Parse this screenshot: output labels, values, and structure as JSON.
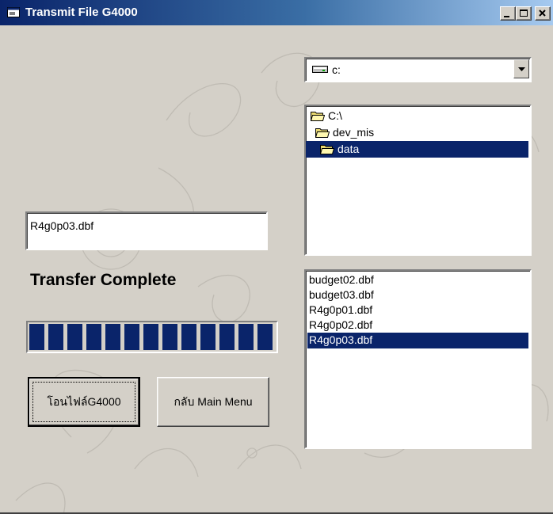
{
  "window": {
    "title": "Transmit File G4000",
    "controls": {
      "minimize": "_",
      "maximize": "□",
      "close": "×"
    }
  },
  "drive": {
    "value": "c:",
    "icon": "drive-icon"
  },
  "directories": {
    "items": [
      {
        "label": "C:\\",
        "indent": 0,
        "selected": false,
        "icon": "open-folder-icon"
      },
      {
        "label": "dev_mis",
        "indent": 1,
        "selected": false,
        "icon": "open-folder-icon"
      },
      {
        "label": "data",
        "indent": 2,
        "selected": true,
        "icon": "open-folder-icon"
      }
    ]
  },
  "file_field": {
    "value": "R4g0p03.dbf"
  },
  "status": {
    "text": "Transfer Complete"
  },
  "progress": {
    "percent": 100,
    "blocks": 13
  },
  "buttons": {
    "transfer_label": "โอนไฟล์G4000",
    "main_menu_label": "กลับ Main Menu"
  },
  "files": {
    "items": [
      {
        "label": "budget02.dbf",
        "selected": false
      },
      {
        "label": "budget03.dbf",
        "selected": false
      },
      {
        "label": "R4g0p01.dbf",
        "selected": false
      },
      {
        "label": "R4g0p02.dbf",
        "selected": false
      },
      {
        "label": "R4g0p03.dbf",
        "selected": true
      }
    ]
  },
  "colors": {
    "selection": "#0a246a",
    "face": "#d4d0c8",
    "title_start": "#0a246a",
    "title_end": "#a6caf0"
  }
}
